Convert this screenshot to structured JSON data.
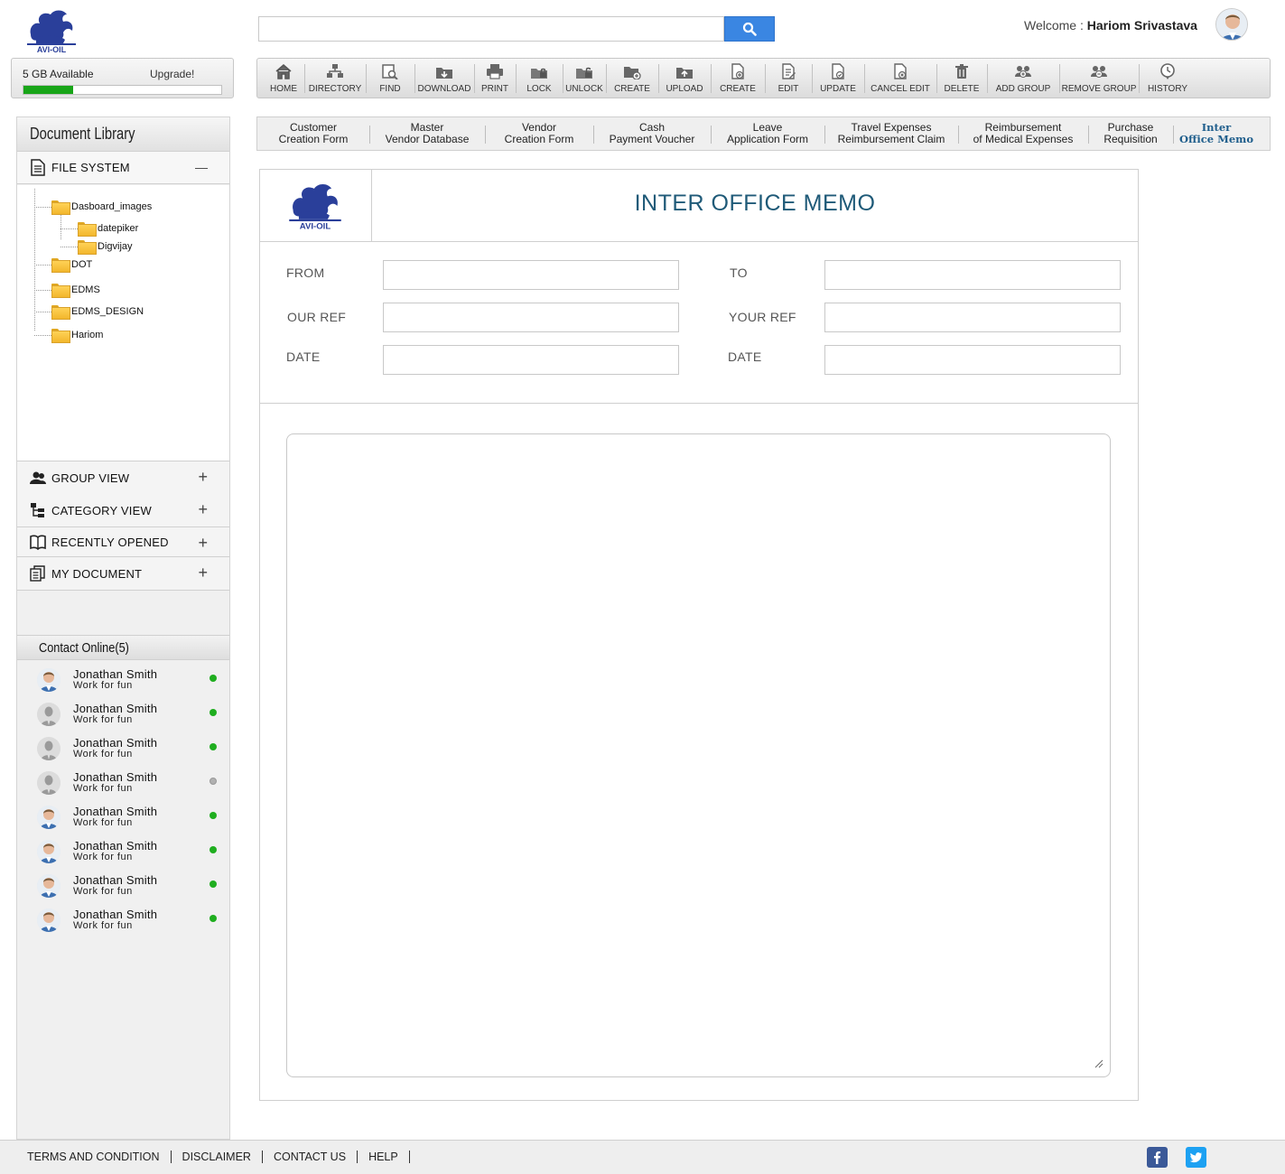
{
  "brand": {
    "logo_text": "AVI-OIL",
    "color": "#2a3f9a"
  },
  "search": {
    "placeholder": "",
    "value": ""
  },
  "user": {
    "welcome_prefix": "Welcome : ",
    "name": "Hariom Srivastava"
  },
  "storage": {
    "label": "5 GB Available",
    "upgrade": "Upgrade!",
    "used_fraction": 0.25,
    "fill_color": "#18a518"
  },
  "toolbar": [
    {
      "label": "HOME",
      "icon": "home-icon"
    },
    {
      "label": "DIRECTORY",
      "icon": "directory-icon"
    },
    {
      "label": "FIND",
      "icon": "find-icon"
    },
    {
      "label": "DOWNLOAD",
      "icon": "download-icon"
    },
    {
      "label": "PRINT",
      "icon": "print-icon"
    },
    {
      "label": "LOCK",
      "icon": "lock-icon"
    },
    {
      "label": "UNLOCK",
      "icon": "unlock-icon"
    },
    {
      "label": "CREATE",
      "icon": "create-folder-icon"
    },
    {
      "label": "UPLOAD",
      "icon": "upload-icon"
    },
    {
      "label": "CREATE",
      "icon": "create-document-icon"
    },
    {
      "label": "EDIT",
      "icon": "edit-icon"
    },
    {
      "label": "UPDATE",
      "icon": "update-icon"
    },
    {
      "label": "CANCEL EDIT",
      "icon": "cancel-edit-icon"
    },
    {
      "label": "DELETE",
      "icon": "delete-icon"
    },
    {
      "label": "ADD GROUP",
      "icon": "add-group-icon"
    },
    {
      "label": "REMOVE GROUP",
      "icon": "remove-group-icon"
    },
    {
      "label": "HISTORY",
      "icon": "history-icon"
    }
  ],
  "tabs": [
    {
      "line1": "Customer",
      "line2": "Creation Form"
    },
    {
      "line1": "Master",
      "line2": "Vendor Database"
    },
    {
      "line1": "Vendor",
      "line2": "Creation Form"
    },
    {
      "line1": "Cash",
      "line2": "Payment Voucher"
    },
    {
      "line1": "Leave",
      "line2": "Application Form"
    },
    {
      "line1": "Travel Expenses",
      "line2": "Reimbursement Claim"
    },
    {
      "line1": "Reimbursement",
      "line2": "of Medical Expenses"
    },
    {
      "line1": "Purchase",
      "line2": "Requisition"
    },
    {
      "line1": "Inter",
      "line2": "Office Memo",
      "active": true
    }
  ],
  "sidebar": {
    "title": "Document Library",
    "file_system": {
      "label": "FILE SYSTEM",
      "toggle": "—"
    },
    "tree": [
      {
        "label": "Dasboard_images"
      },
      {
        "label": "datepiker"
      },
      {
        "label": "Digvijay"
      },
      {
        "label": "DOT"
      },
      {
        "label": "EDMS"
      },
      {
        "label": "EDMS_DESIGN"
      },
      {
        "label": "Hariom"
      }
    ],
    "sections": [
      {
        "label": "GROUP VIEW",
        "toggle": "+",
        "icon": "group-icon"
      },
      {
        "label": "CATEGORY VIEW",
        "toggle": "+",
        "icon": "category-icon"
      },
      {
        "label": "RECENTLY OPENED",
        "toggle": "+",
        "icon": "book-icon"
      },
      {
        "label": "MY DOCUMENT",
        "toggle": "+",
        "icon": "documents-icon"
      }
    ],
    "contacts_title": "Contact Online(5)",
    "contacts": [
      {
        "name": "Jonathan Smith",
        "status": "Work for fun",
        "online": true,
        "photo": true
      },
      {
        "name": "Jonathan Smith",
        "status": "Work for fun",
        "online": true,
        "photo": false
      },
      {
        "name": "Jonathan Smith",
        "status": "Work for fun",
        "online": true,
        "photo": false
      },
      {
        "name": "Jonathan Smith",
        "status": "Work for fun",
        "online": false,
        "photo": false
      },
      {
        "name": "Jonathan Smith",
        "status": "Work for fun",
        "online": true,
        "photo": true
      },
      {
        "name": "Jonathan Smith",
        "status": "Work for fun",
        "online": true,
        "photo": true
      },
      {
        "name": "Jonathan Smith",
        "status": "Work for fun",
        "online": true,
        "photo": true
      },
      {
        "name": "Jonathan Smith",
        "status": "Work for fun",
        "online": true,
        "photo": true
      }
    ],
    "online_color": "#1fae1f",
    "offline_color": "#b0b0b0"
  },
  "memo": {
    "title": "INTER OFFICE MEMO",
    "fields": {
      "from": {
        "label": "FROM",
        "value": ""
      },
      "to": {
        "label": "TO",
        "value": ""
      },
      "our_ref": {
        "label": "OUR REF",
        "value": ""
      },
      "your_ref": {
        "label": "YOUR REF",
        "value": ""
      },
      "date_left": {
        "label": "DATE",
        "value": ""
      },
      "date_right": {
        "label": "DATE",
        "value": ""
      }
    },
    "body": ""
  },
  "footer": {
    "links": [
      "TERMS AND CONDITION",
      "DISCLAIMER",
      "CONTACT US",
      "HELP"
    ],
    "social": [
      {
        "icon": "facebook-icon",
        "color": "#3b5998"
      },
      {
        "icon": "twitter-icon",
        "color": "#1da1f2"
      }
    ]
  }
}
